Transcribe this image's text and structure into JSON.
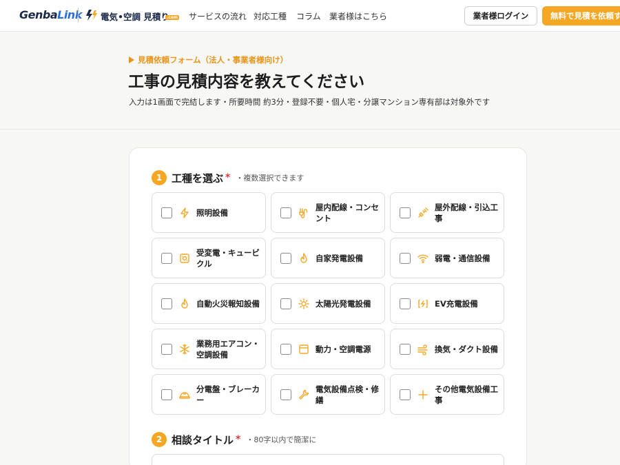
{
  "header": {
    "logo_main": "Genba",
    "logo_accent": "Link",
    "brand_name": "電気•空調 見積り",
    "brand_tag": ".com",
    "nav": [
      "サービスの流れ",
      "対応工種",
      "コラム",
      "業者様はこちら"
    ],
    "login_label": "業者様ログイン",
    "quote_label": "無料で見積を依頼す"
  },
  "hero": {
    "eyebrow": "見積依頼フォーム（法人・事業者様向け）",
    "title": "工事の見積内容を教えてください",
    "subtitle": "入力は1画面で完結します・所要時間 約3分・登録不要・個人宅・分譲マンション専有部は対象外です"
  },
  "step1": {
    "number": "1",
    "title": "工種を選ぶ",
    "required_mark": "*",
    "hint": "・複数選択できます"
  },
  "options": [
    {
      "label": "照明設備",
      "icon": "bolt-icon"
    },
    {
      "label": "屋内配線・コンセント",
      "icon": "outlet-icon"
    },
    {
      "label": "屋外配線・引込工事",
      "icon": "plug-icon"
    },
    {
      "label": "受変電・キュービクル",
      "icon": "cubicle-icon"
    },
    {
      "label": "自家発電設備",
      "icon": "flame-icon"
    },
    {
      "label": "弱電・通信設備",
      "icon": "wifi-icon"
    },
    {
      "label": "自動火災報知設備",
      "icon": "fire-icon"
    },
    {
      "label": "太陽光発電設備",
      "icon": "sun-icon"
    },
    {
      "label": "EV充電設備",
      "icon": "ev-charger-icon"
    },
    {
      "label": "業務用エアコン・空調設備",
      "icon": "snowflake-icon"
    },
    {
      "label": "動力・空調電源",
      "icon": "panel-icon"
    },
    {
      "label": "換気・ダクト設備",
      "icon": "wind-icon"
    },
    {
      "label": "分電盤・ブレーカー",
      "icon": "helmet-icon"
    },
    {
      "label": "電気設備点検・修繕",
      "icon": "wrench-icon"
    },
    {
      "label": "その他電気設備工事",
      "icon": "plus-icon"
    }
  ],
  "step2": {
    "number": "2",
    "title": "相談タイトル",
    "required_mark": "*",
    "hint": "・80字以内で簡潔に"
  },
  "colors": {
    "accent": "#f5a623",
    "required": "#e53935"
  }
}
